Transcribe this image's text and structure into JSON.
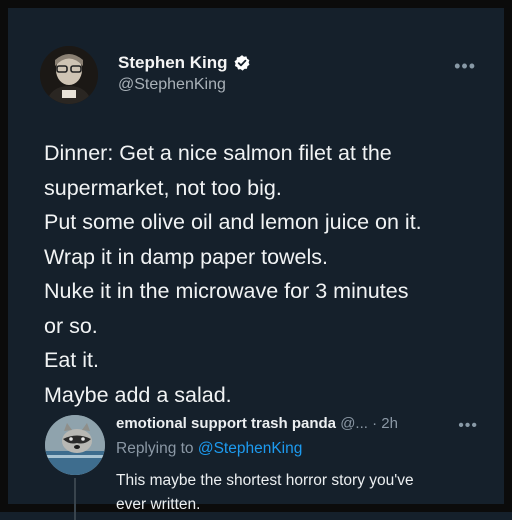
{
  "tweet": {
    "author_name": "Stephen King",
    "handle": "@StephenKing",
    "more_icon": "more-horizontal-icon",
    "lines": [
      "Dinner: Get a nice salmon filet at the",
      "supermarket, not too big.",
      "Put some olive oil and lemon juice on it.",
      "Wrap it in damp paper towels.",
      "Nuke it in the microwave for 3 minutes",
      "or so.",
      "Eat it.",
      "Maybe add a salad."
    ]
  },
  "reply": {
    "author_name": "emotional support trash panda",
    "handle": "@...",
    "separator": "·",
    "time": "2h",
    "replying_prefix": "Replying to",
    "replying_handle": "@StephenKing",
    "text_lines": [
      "This maybe the shortest horror story you've",
      "ever written."
    ]
  },
  "colors": {
    "background": "#15202b",
    "accent_link": "#1d9bf0",
    "verified_badge": "#ffffff"
  }
}
